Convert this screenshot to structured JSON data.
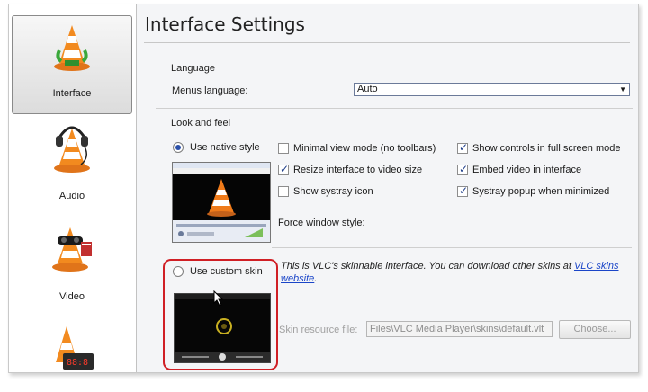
{
  "sidebar": {
    "items": [
      {
        "label": "Interface",
        "selected": true
      },
      {
        "label": "Audio",
        "selected": false
      },
      {
        "label": "Video",
        "selected": false
      },
      {
        "label": "",
        "selected": false
      }
    ]
  },
  "main": {
    "title": "Interface Settings",
    "language": {
      "section_title": "Language",
      "menus_label": "Menus language:",
      "menus_value": "Auto"
    },
    "look_feel": {
      "section_title": "Look and feel",
      "native_style_label": "Use native style",
      "native_style_selected": true,
      "checkboxes": [
        {
          "label": "Minimal view mode (no toolbars)",
          "checked": false
        },
        {
          "label": "Show controls in full screen mode",
          "checked": true
        },
        {
          "label": "Resize interface to video size",
          "checked": true
        },
        {
          "label": "Embed video in interface",
          "checked": true
        },
        {
          "label": "Show systray icon",
          "checked": false
        },
        {
          "label": "Systray popup when minimized",
          "checked": true
        }
      ],
      "force_window_style_label": "Force window style:",
      "custom_skin_label": "Use custom skin",
      "custom_skin_selected": false,
      "skin_description": "This is VLC's skinnable interface. You can download other skins at ",
      "skin_link_text": "VLC skins website",
      "skin_description_end": ".",
      "skin_resource_label": "Skin resource file:",
      "skin_resource_value": "Files\\VLC Media Player\\skins\\default.vlt",
      "choose_button": "Choose..."
    }
  },
  "colors": {
    "highlight_box": "#d01f25",
    "cone_orange": "#f07b1a",
    "link": "#1a45c8"
  },
  "icons": [
    "vlc-cone-icon",
    "vlc-cone-headphones-icon",
    "vlc-cone-video-icon",
    "vlc-cone-clock-icon",
    "cursor-icon"
  ]
}
